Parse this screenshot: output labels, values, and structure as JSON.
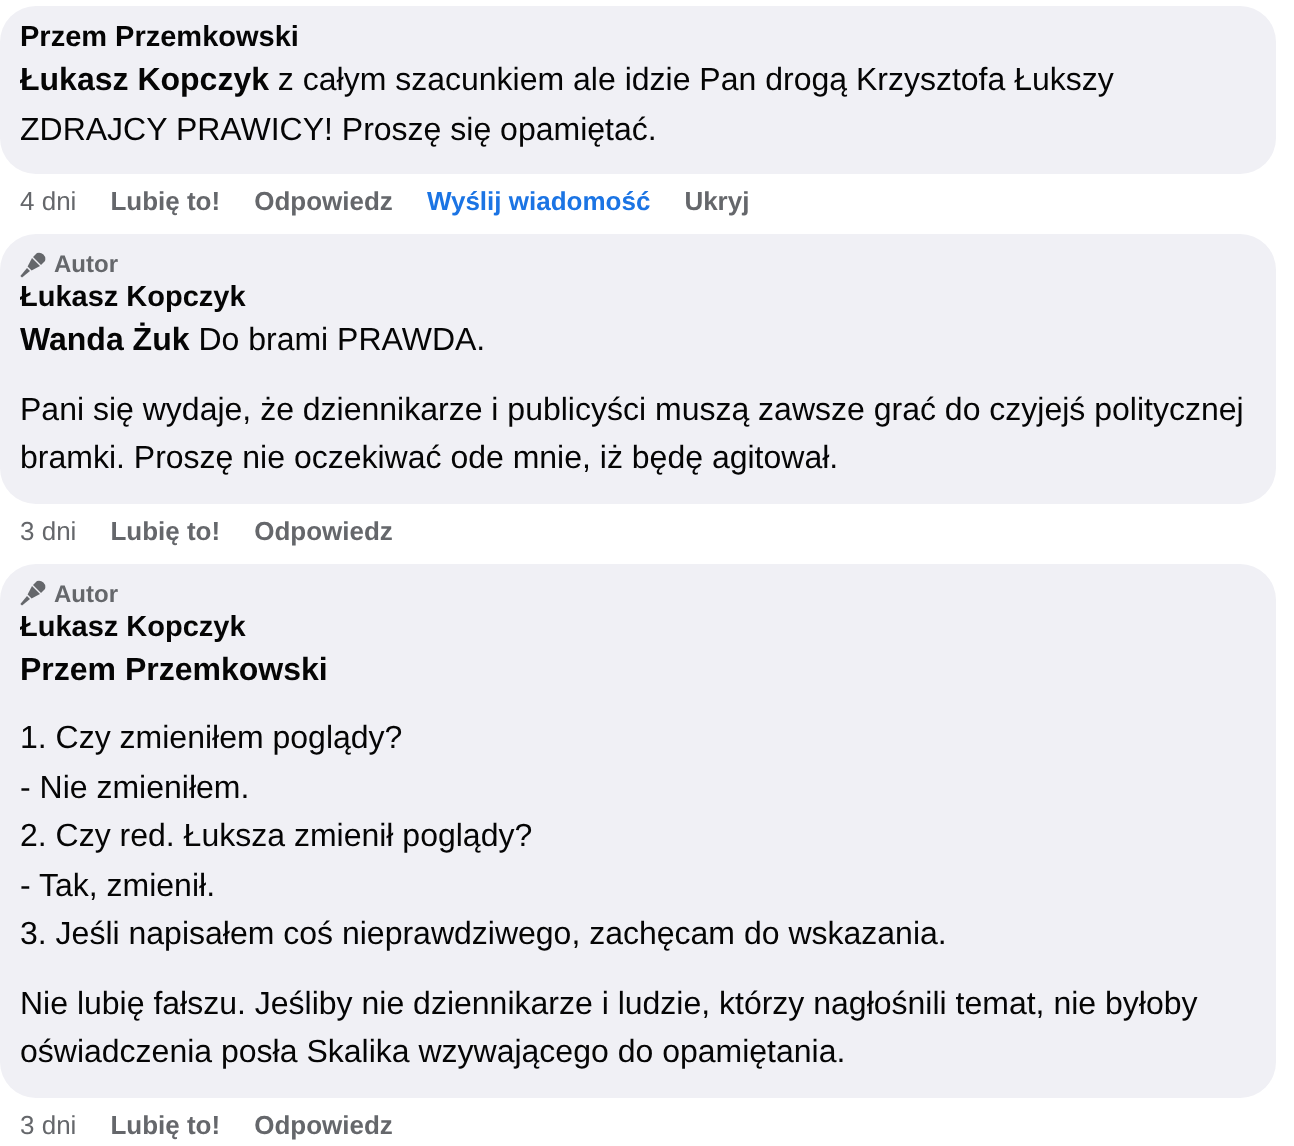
{
  "comments": [
    {
      "author": "Przem Przemkowski",
      "paragraphs": [
        {
          "kind": "text",
          "text": "**Łukasz Kopczyk** z całym szacunkiem ale idzie Pan drogą Krzysztofa Łukszy ZDRAJCY PRAWICY! Proszę się opamiętać."
        }
      ],
      "time": "4 dni",
      "actions": [
        {
          "label": "Lubię to!",
          "highlighted": false
        },
        {
          "label": "Odpowiedz",
          "highlighted": false
        },
        {
          "label": "Wyślij wiadomość",
          "highlighted": true
        },
        {
          "label": "Ukryj",
          "highlighted": false
        }
      ]
    },
    {
      "badge": "Autor",
      "author": "Łukasz Kopczyk",
      "paragraphs": [
        {
          "kind": "text",
          "text": "**Wanda Żuk** Do brami PRAWDA."
        },
        {
          "kind": "text",
          "text": "Pani się wydaje, że dziennikarze i publicyści muszą zawsze grać do czyjejś politycznej bramki. Proszę nie oczekiwać ode mnie, iż będę agitował."
        }
      ],
      "time": "3 dni",
      "actions": [
        {
          "label": "Lubię to!",
          "highlighted": false
        },
        {
          "label": "Odpowiedz",
          "highlighted": false
        }
      ]
    },
    {
      "badge": "Autor",
      "author": "Łukasz Kopczyk",
      "paragraphs": [
        {
          "kind": "mention",
          "text": "Przem Przemkowski"
        },
        {
          "kind": "lines",
          "lines": [
            "1. Czy zmieniłem poglądy?",
            "- Nie zmieniłem.",
            "2. Czy red. Łuksza zmienił poglądy?",
            "- Tak, zmienił.",
            "3. Jeśli napisałem coś nieprawdziwego, zachęcam do wskazania."
          ]
        },
        {
          "kind": "text",
          "text": "Nie lubię fałszu. Jeśliby nie dziennikarze i ludzie, którzy nagłośnili temat, nie byłoby oświadczenia posła Skalika wzywającego do opamiętania."
        }
      ],
      "time": "3 dni",
      "actions": [
        {
          "label": "Lubię to!",
          "highlighted": false
        },
        {
          "label": "Odpowiedz",
          "highlighted": false
        }
      ]
    }
  ]
}
